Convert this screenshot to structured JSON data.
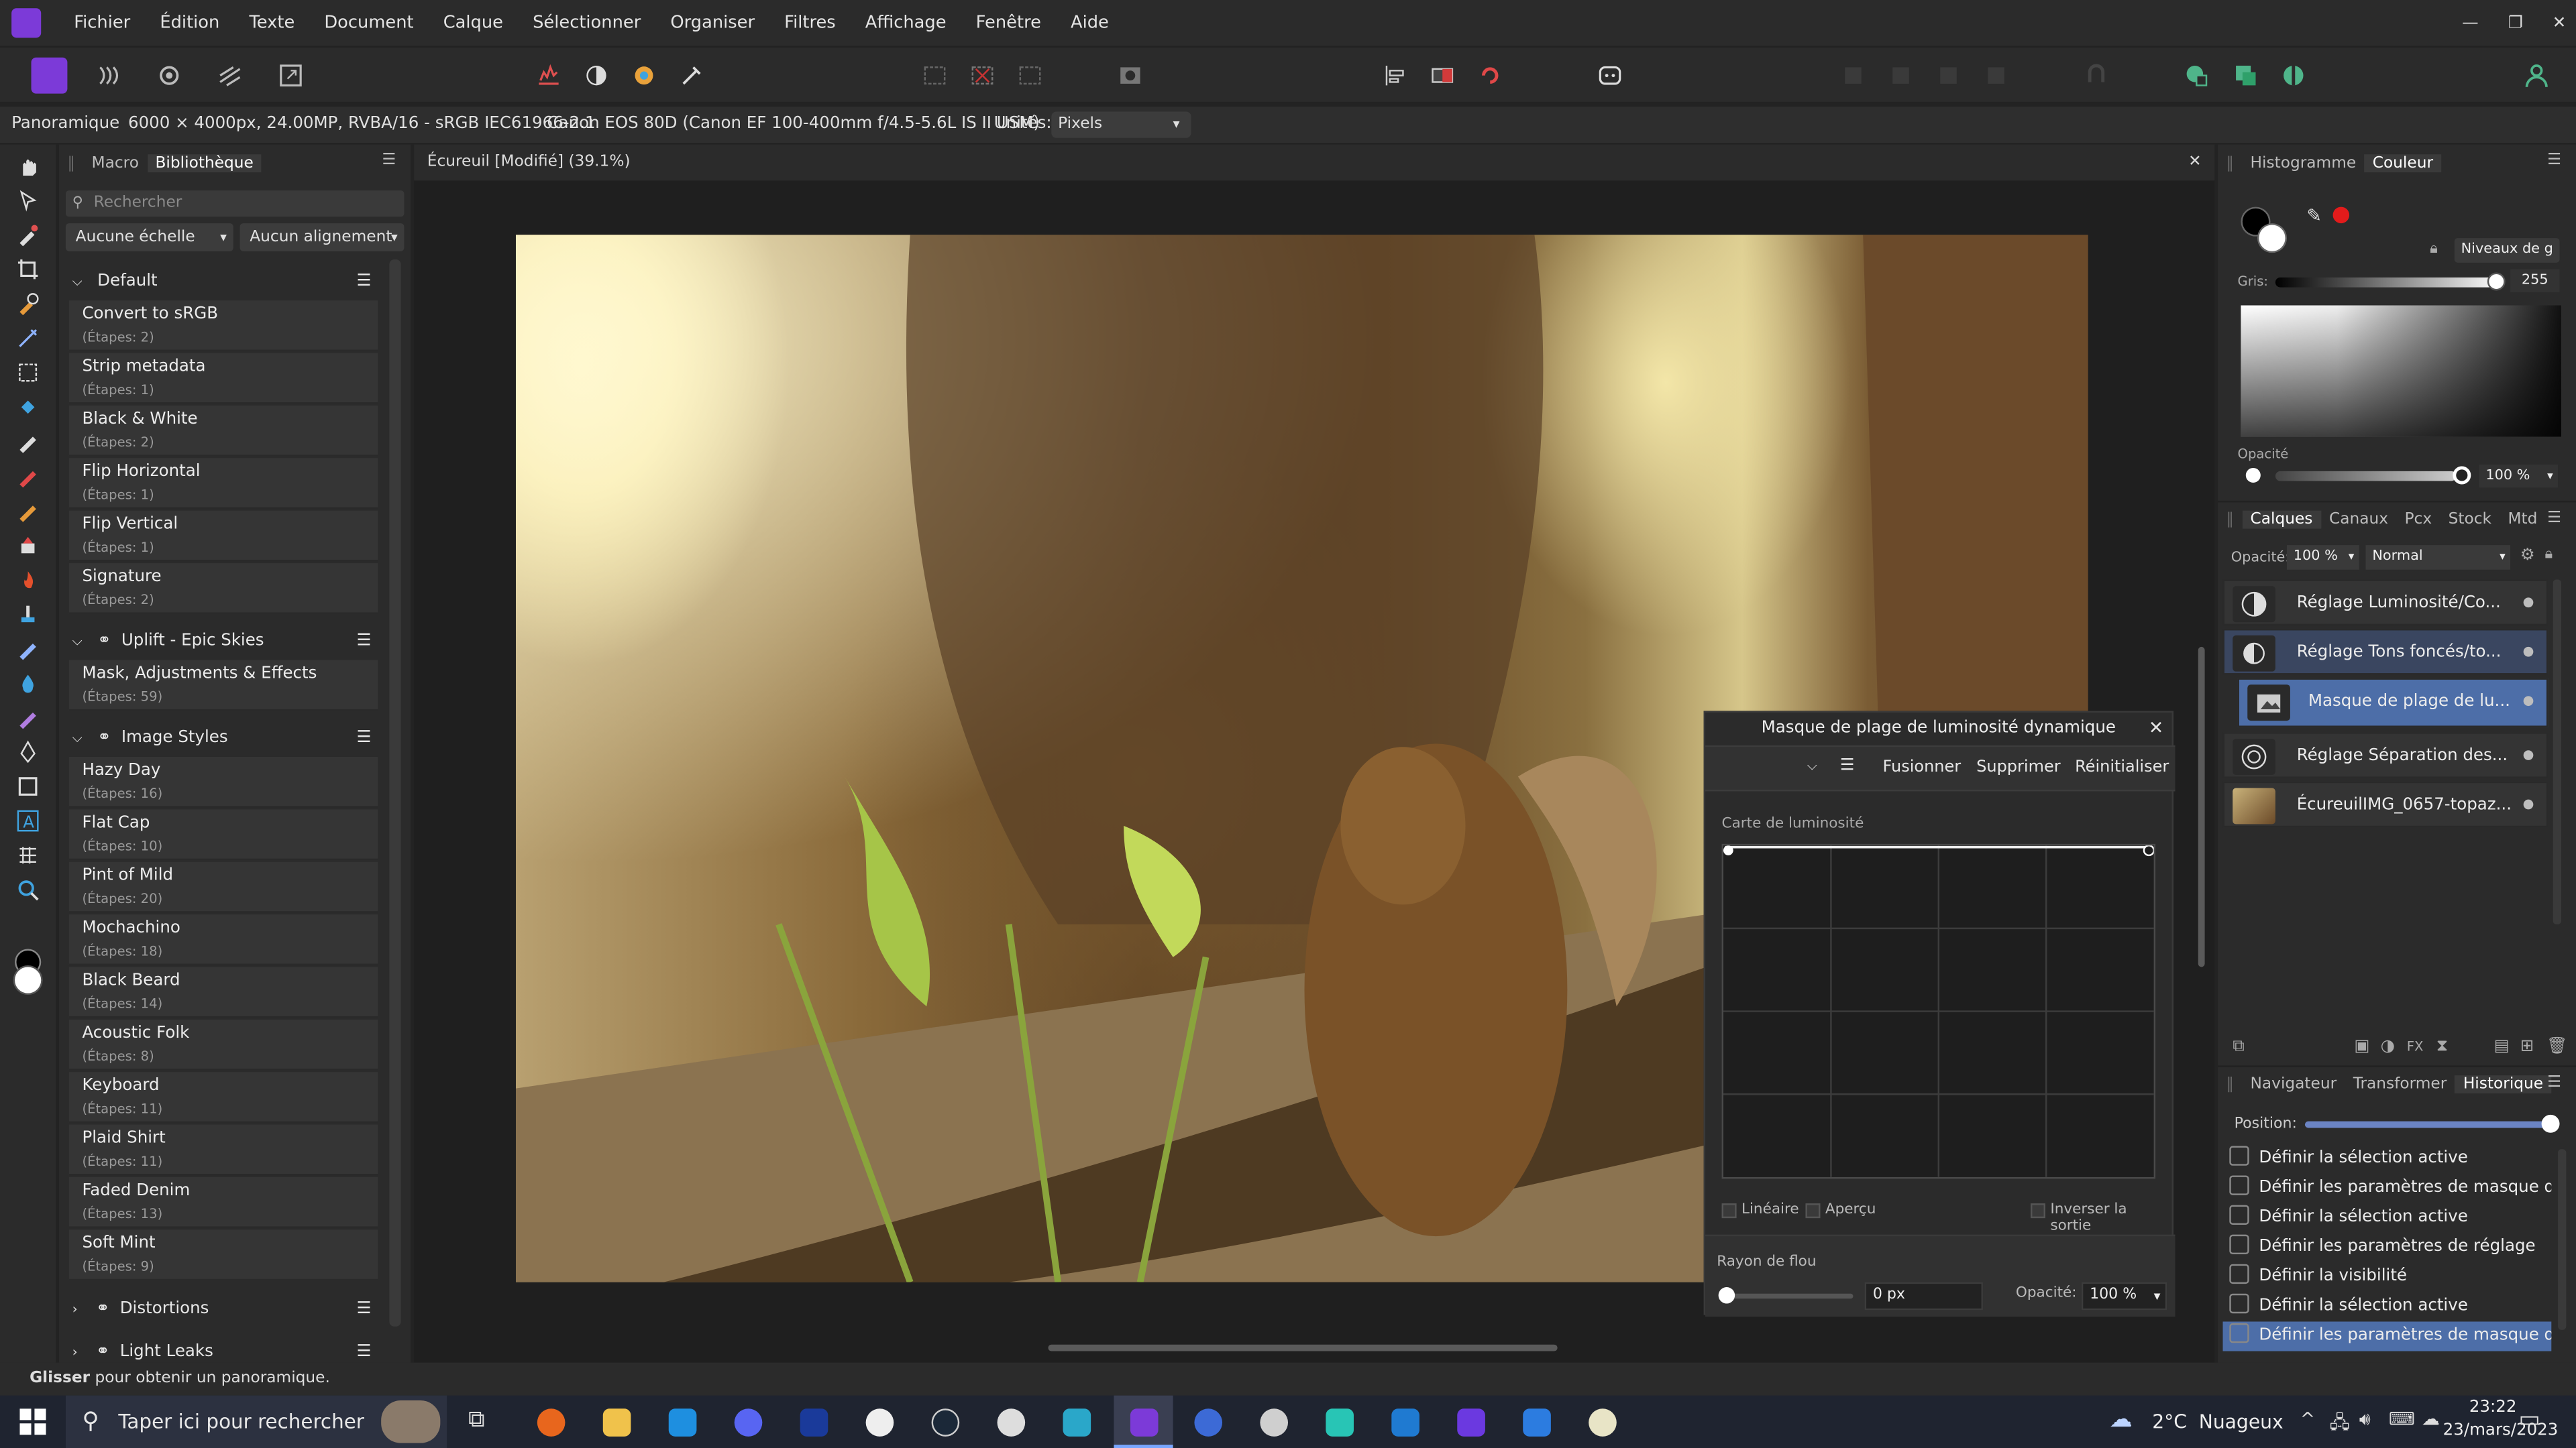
{
  "menubar": {
    "items": [
      "Fichier",
      "Édition",
      "Texte",
      "Document",
      "Calque",
      "Sélectionner",
      "Organiser",
      "Filtres",
      "Affichage",
      "Fenêtre",
      "Aide"
    ]
  },
  "context_bar": {
    "persona": "Panoramique",
    "doc_info": "6000 × 4000px, 24.00MP, RVBA/16 - sRGB IEC61966-2.1",
    "camera": "Canon EOS 80D (Canon EF 100-400mm f/4.5-5.6L IS II USM)",
    "units_label": "Unités:",
    "units_value": "Pixels"
  },
  "left_panel": {
    "tabs": [
      "Macro",
      "Bibliothèque"
    ],
    "search_placeholder": "Rechercher",
    "scale_select": "Aucune échelle",
    "align_select": "Aucun alignement",
    "categories": {
      "default": {
        "name": "Default",
        "macros": [
          {
            "name": "Convert to sRGB",
            "steps": "(Étapes: 2)"
          },
          {
            "name": "Strip metadata",
            "steps": "(Étapes: 1)"
          },
          {
            "name": "Black & White",
            "steps": "(Étapes: 2)"
          },
          {
            "name": "Flip Horizontal",
            "steps": "(Étapes: 1)"
          },
          {
            "name": "Flip Vertical",
            "steps": "(Étapes: 1)"
          },
          {
            "name": "Signature",
            "steps": "(Étapes: 2)"
          }
        ]
      },
      "uplift": {
        "name": "Uplift - Epic Skies",
        "macros": [
          {
            "name": "Mask, Adjustments & Effects",
            "steps": "(Étapes: 59)"
          }
        ]
      },
      "image_styles": {
        "name": "Image Styles",
        "macros": [
          {
            "name": "Hazy Day",
            "steps": "(Étapes: 16)"
          },
          {
            "name": "Flat Cap",
            "steps": "(Étapes: 10)"
          },
          {
            "name": "Pint of Mild",
            "steps": "(Étapes: 20)"
          },
          {
            "name": "Mochachino",
            "steps": "(Étapes: 18)"
          },
          {
            "name": "Black Beard",
            "steps": "(Étapes: 14)"
          },
          {
            "name": "Acoustic Folk",
            "steps": "(Étapes: 8)"
          },
          {
            "name": "Keyboard",
            "steps": "(Étapes: 11)"
          },
          {
            "name": "Plaid Shirt",
            "steps": "(Étapes: 11)"
          },
          {
            "name": "Faded Denim",
            "steps": "(Étapes: 13)"
          },
          {
            "name": "Soft Mint",
            "steps": "(Étapes: 9)"
          }
        ]
      },
      "distortions": {
        "name": "Distortions"
      },
      "light_leaks": {
        "name": "Light Leaks"
      }
    }
  },
  "document": {
    "tab_title": "Écureuil [Modifié] (39.1%)"
  },
  "dialog": {
    "title": "Masque de plage de luminosité dynamique",
    "merge_label": "Fusionner",
    "delete_label": "Supprimer",
    "reset_label": "Réinitialiser",
    "map_label": "Carte de luminosité",
    "linear_label": "Linéaire",
    "preview_label": "Aperçu",
    "invert_label": "Inverser la sortie",
    "blur_label": "Rayon de flou",
    "blur_value": "0 px",
    "opacity_label": "Opacité:",
    "opacity_value": "100 %"
  },
  "color_panel": {
    "tabs": [
      "Histogramme",
      "Couleur"
    ],
    "mode_select": "Niveaux de g",
    "gray_label": "Gris:",
    "gray_value": "255",
    "opacity_label": "Opacité",
    "opacity_value": "100 %",
    "fg_color": "#000000",
    "bg_color": "#ffffff",
    "accent_red": "#e31b1b"
  },
  "layers_panel": {
    "tabs": [
      "Calques",
      "Canaux",
      "Pcx",
      "Stock",
      "Mtd"
    ],
    "opacity_label": "Opacité:",
    "opacity_value": "100 %",
    "blend_mode": "Normal",
    "layers": [
      {
        "name": "Réglage Luminosité/Co..."
      },
      {
        "name": "Réglage Tons foncés/to..."
      },
      {
        "name": "Masque de plage de lu..."
      },
      {
        "name": "Réglage Séparation des..."
      },
      {
        "name": "ÉcureuilIMG_0657-topaz..."
      }
    ]
  },
  "history_panel": {
    "tabs": [
      "Navigateur",
      "Transformer",
      "Historique"
    ],
    "position_label": "Position:",
    "position_fraction": 1.0,
    "items": [
      "Définir la sélection active",
      "Définir les paramètres de masque de pl...",
      "Définir la sélection active",
      "Définir les paramètres de réglage",
      "Définir la visibilité",
      "Définir la sélection active",
      "Définir les paramètres de masque de pl..."
    ]
  },
  "status_bar": {
    "bold": "Glisser",
    "text": "pour obtenir un panoramique."
  },
  "taskbar": {
    "search_placeholder": "Taper ici pour rechercher",
    "weather": "2°C  Nuageux",
    "time": "23:22",
    "date": "23/mars/2023"
  }
}
